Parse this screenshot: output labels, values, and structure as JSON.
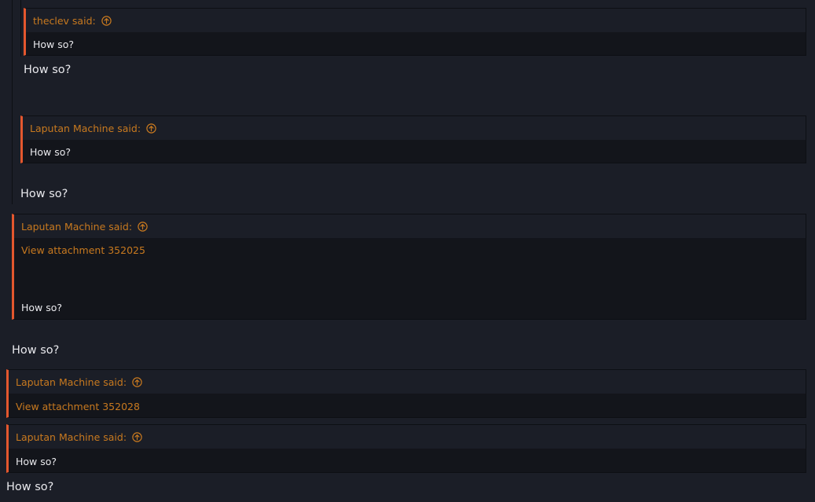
{
  "colors": {
    "background": "#1b1e27",
    "quote_body": "#13151b",
    "accent_border": "#e4572e",
    "link": "#c8791f",
    "text": "#e8e8ec"
  },
  "quotes": [
    {
      "author_line": "theclev said:",
      "icon": "arrow-up-circle-icon",
      "lines": [
        "How so?"
      ]
    },
    {
      "author_line": "Laputan Machine said:",
      "icon": "arrow-up-circle-icon",
      "lines": [
        "How so?"
      ]
    },
    {
      "author_line": "Laputan Machine said:",
      "icon": "arrow-up-circle-icon",
      "attachment": "View attachment 352025",
      "lines": [
        "How so?"
      ]
    },
    {
      "author_line": "Laputan Machine said:",
      "icon": "arrow-up-circle-icon",
      "attachment": "View attachment 352028"
    },
    {
      "author_line": "Laputan Machine said:",
      "icon": "arrow-up-circle-icon",
      "lines": [
        "How so?"
      ]
    }
  ],
  "replies": [
    "How so?",
    "How so?",
    "How so?",
    "How so?"
  ]
}
